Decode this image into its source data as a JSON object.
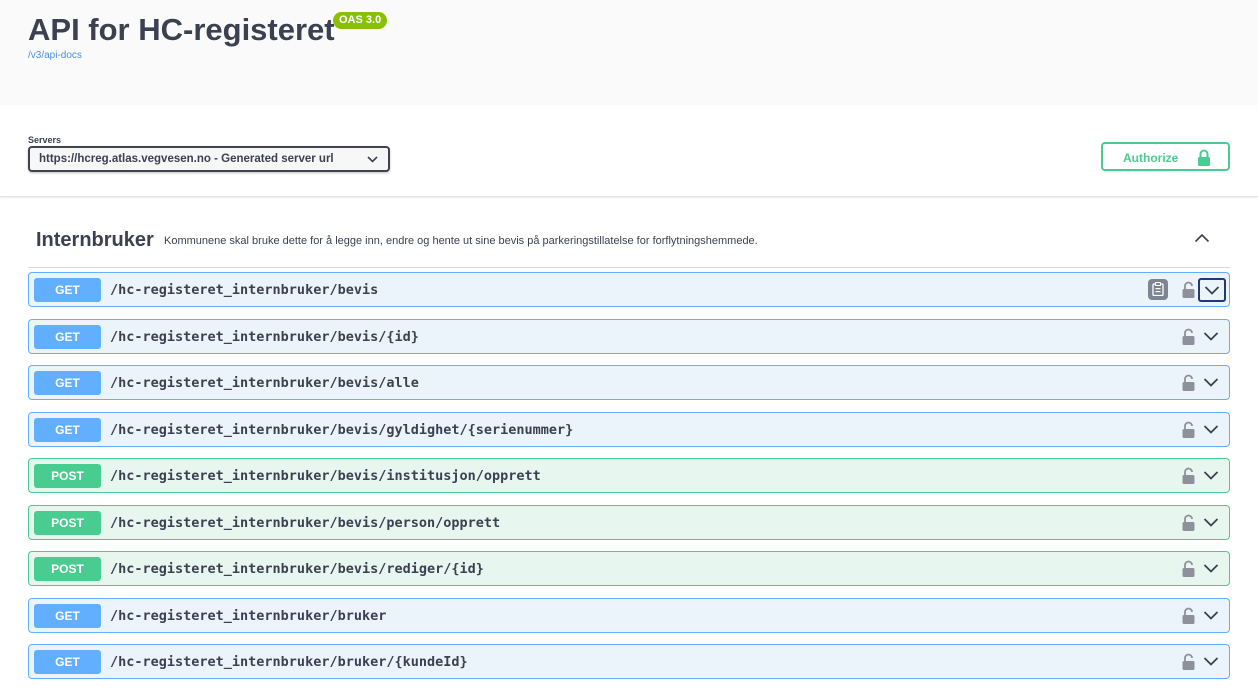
{
  "info": {
    "title": "API for HC-registeret",
    "version_badge": "OAS 3.0",
    "docs_link": "/v3/api-docs"
  },
  "servers": {
    "label": "Servers",
    "selected": "https://hcreg.atlas.vegvesen.no - Generated server url"
  },
  "authorize": {
    "label": "Authorize"
  },
  "tag": {
    "name": "Internbruker",
    "description": "Kommunene skal bruke dette for å legge inn, endre og hente ut sine bevis på parkeringstillatelse for forflytningshemmede."
  },
  "operations": [
    {
      "method": "GET",
      "path": "/hc-registeret_internbruker/bevis"
    },
    {
      "method": "GET",
      "path": "/hc-registeret_internbruker/bevis/{id}"
    },
    {
      "method": "GET",
      "path": "/hc-registeret_internbruker/bevis/alle"
    },
    {
      "method": "GET",
      "path": "/hc-registeret_internbruker/bevis/gyldighet/{serienummer}"
    },
    {
      "method": "POST",
      "path": "/hc-registeret_internbruker/bevis/institusjon/opprett"
    },
    {
      "method": "POST",
      "path": "/hc-registeret_internbruker/bevis/person/opprett"
    },
    {
      "method": "POST",
      "path": "/hc-registeret_internbruker/bevis/rediger/{id}"
    },
    {
      "method": "GET",
      "path": "/hc-registeret_internbruker/bruker"
    },
    {
      "method": "GET",
      "path": "/hc-registeret_internbruker/bruker/{kundeId}"
    }
  ],
  "colors": {
    "get": "#61affe",
    "post": "#49cc90",
    "badge": "#89bf04"
  },
  "icons": [
    "chevron-down-icon",
    "lock-icon",
    "chevron-up-icon",
    "copy-icon"
  ]
}
